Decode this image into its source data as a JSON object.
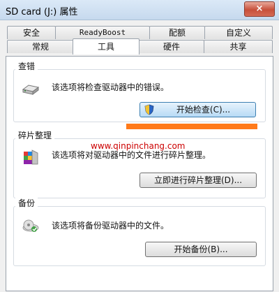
{
  "window": {
    "title": "SD card (J:) 属性",
    "close": "×"
  },
  "tabs_row1": [
    "安全",
    "ReadyBoost",
    "配额",
    "自定义"
  ],
  "tabs_row2": [
    "常规",
    "工具",
    "硬件",
    "共享"
  ],
  "active_tab": "工具",
  "groups": {
    "check": {
      "title": "查错",
      "description": "该选项将检查驱动器中的错误。",
      "button": "开始检查(C)..."
    },
    "defrag": {
      "title": "碎片整理",
      "description": "该选项将对驱动器中的文件进行碎片整理。",
      "button": "立即进行碎片整理(D)..."
    },
    "backup": {
      "title": "备份",
      "description": "该选项将备份驱动器中的文件。",
      "button": "开始备份(B)..."
    }
  },
  "watermark": "www.qinpinchang.com",
  "colors": {
    "highlight": "#ff7a1a",
    "watermark": "#cc0000"
  },
  "icons": {
    "drive": "hard-drive-icon",
    "defrag": "defrag-icon",
    "backup": "backup-icon",
    "shield": "uac-shield-icon"
  }
}
